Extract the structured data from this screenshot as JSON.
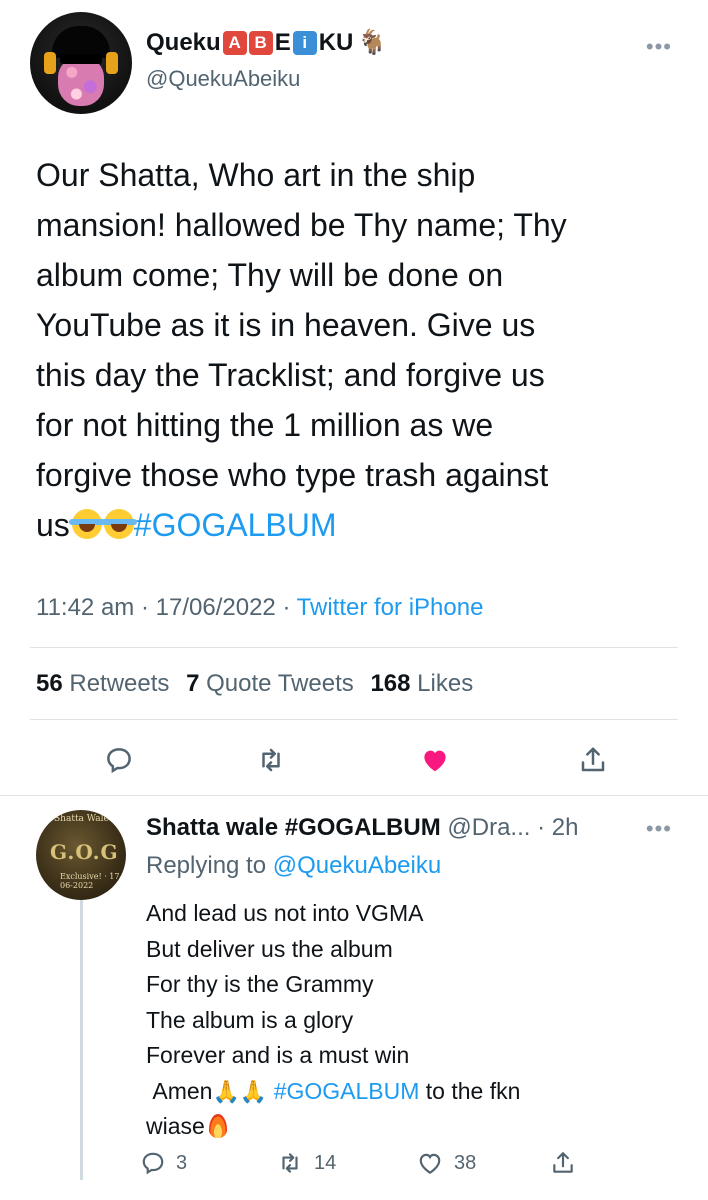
{
  "tweet": {
    "author": {
      "name_parts": [
        "Queku",
        "A",
        "B",
        "E",
        "i",
        "KU"
      ],
      "handle": "@QuekuAbeiku"
    },
    "text_lines": [
      "Our Shatta, Who art in the ship",
      "mansion! hallowed be Thy name; Thy",
      "album come; Thy will be done on",
      "YouTube as it is in heaven. Give us",
      "this day the Tracklist; and forgive us",
      "for not hitting the 1 million as we",
      "forgive those who type trash against",
      "us"
    ],
    "hashtag": "#GOGALBUM",
    "time": "11:42 am",
    "sep": "·",
    "date": "17/06/2022",
    "source": "Twitter for iPhone",
    "stats": {
      "retweets": "56",
      "retweets_label": "Retweets",
      "quotes": "7",
      "quotes_label": "Quote Tweets",
      "likes": "168",
      "likes_label": "Likes"
    },
    "liked": true,
    "like_color": "#f91880"
  },
  "reply": {
    "author_name": "Shatta wale #GOGALBUM",
    "handle": "@Dra...",
    "time": "· 2h",
    "replying_prefix": "Replying to",
    "replying_to": "@QuekuAbeiku",
    "avatar_text": {
      "top": "Shatta Wale",
      "mid": "G.O.G",
      "bottom": "Exclusive! · 17-06-2022"
    },
    "lines": [
      "And lead us not into VGMA",
      "But deliver us the album",
      "For thy is the Grammy",
      "The album is a glory",
      "Forever and is a must win"
    ],
    "amen": "Amen",
    "hashtag": "#GOGALBUM",
    "tail": "to the fkn",
    "last": "wiase",
    "counts": {
      "replies": "3",
      "retweets": "14",
      "likes": "38"
    }
  },
  "icons": [
    "more-icon",
    "reply-icon",
    "retweet-icon",
    "like-icon",
    "share-icon",
    "laugh-cry-emoji",
    "pray-emoji",
    "fire-emoji",
    "goat-emoji"
  ],
  "colors": {
    "link": "#1d9bf0",
    "muted": "#536471",
    "text": "#0f1419"
  }
}
